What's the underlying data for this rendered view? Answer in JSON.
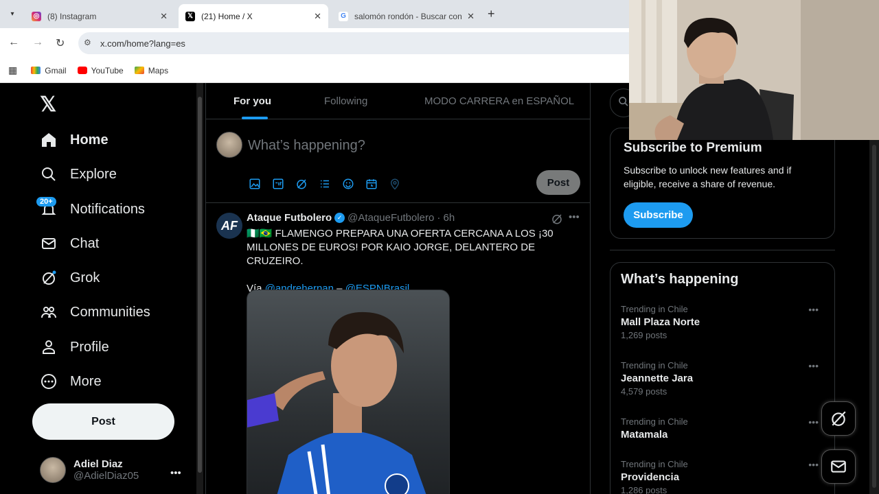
{
  "browser": {
    "tabs": [
      {
        "title": "(8) Instagram",
        "favicon": "instagram-icon",
        "active": false
      },
      {
        "title": "(21) Home / X",
        "favicon": "x-icon",
        "active": true
      },
      {
        "title": "salomón rondón - Buscar con G",
        "favicon": "google-icon",
        "active": false
      }
    ],
    "url": "x.com/home?lang=es",
    "bookmarks": [
      "Gmail",
      "YouTube",
      "Maps"
    ]
  },
  "sidebar": {
    "items": [
      {
        "label": "Home",
        "icon": "home-icon"
      },
      {
        "label": "Explore",
        "icon": "search-icon"
      },
      {
        "label": "Notifications",
        "icon": "bell-icon"
      },
      {
        "label": "Chat",
        "icon": "mail-icon"
      },
      {
        "label": "Grok",
        "icon": "grok-icon"
      },
      {
        "label": "Communities",
        "icon": "communities-icon"
      },
      {
        "label": "Profile",
        "icon": "profile-icon"
      },
      {
        "label": "More",
        "icon": "more-circle-icon"
      }
    ],
    "notif_badge": "20+",
    "post_label": "Post",
    "account": {
      "name": "Adiel Diaz",
      "handle": "@AdielDiaz05"
    }
  },
  "feed": {
    "tabs": [
      "For you",
      "Following",
      "MODO CARRERA en ESPAÑOL"
    ],
    "compose_placeholder": "What’s happening?",
    "compose_post": "Post",
    "tweet": {
      "author": "Ataque Futbolero",
      "handle": "@AtaqueFutbolero",
      "time": "· 6h",
      "line1": "🇳🇬🇧🇷 FLAMENGO PREPARA UNA OFERTA CERCANA A LOS ¡30 MILLONES DE EUROS! POR KAIO JORGE, DELANTERO DE CRUZEIRO.",
      "via": "Vía",
      "mention1": "@andrehernan",
      "dash": "–",
      "mention2": "@ESPNBrasil",
      "dot": "."
    }
  },
  "right": {
    "premium": {
      "title": "Subscribe to Premium",
      "text": "Subscribe to unlock new features and if eligible, receive a share of revenue.",
      "button": "Subscribe"
    },
    "happening_title": "What’s happening",
    "trends": [
      {
        "context": "Trending in Chile",
        "topic": "Mall Plaza Norte",
        "posts": "1,269 posts"
      },
      {
        "context": "Trending in Chile",
        "topic": "Jeannette Jara",
        "posts": "4,579 posts"
      },
      {
        "context": "Trending in Chile",
        "topic": "Matamala",
        "posts": ""
      },
      {
        "context": "Trending in Chile",
        "topic": "Providencia",
        "posts": "1,286 posts"
      }
    ]
  }
}
